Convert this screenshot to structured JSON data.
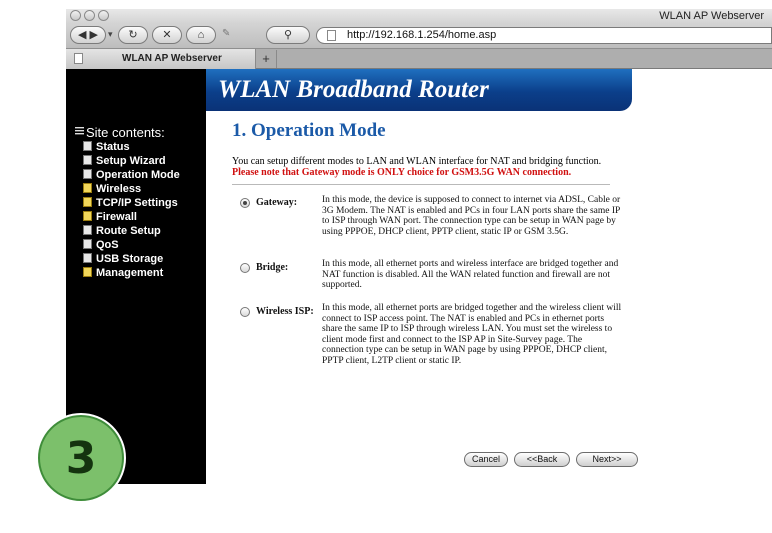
{
  "window": {
    "title": "WLAN AP Webserver"
  },
  "toolbar": {
    "back_icon": "back-arrow-icon",
    "forward_icon": "forward-arrow-icon",
    "reload_icon": "reload-icon",
    "stop_icon": "stop-icon",
    "home_icon": "home-icon",
    "url": "http://192.168.1.254/home.asp"
  },
  "tabs": [
    {
      "label": "WLAN AP Webserver"
    }
  ],
  "banner": {
    "title": "WLAN Broadband Router"
  },
  "sidebar": {
    "heading": "Site contents:",
    "items": [
      {
        "label": "Status",
        "icon": "page-icon"
      },
      {
        "label": "Setup Wizard",
        "icon": "page-icon"
      },
      {
        "label": "Operation Mode",
        "icon": "page-icon"
      },
      {
        "label": "Wireless",
        "icon": "folder-icon"
      },
      {
        "label": "TCP/IP Settings",
        "icon": "folder-icon"
      },
      {
        "label": "Firewall",
        "icon": "folder-icon"
      },
      {
        "label": "Route Setup",
        "icon": "page-icon"
      },
      {
        "label": "QoS",
        "icon": "page-icon"
      },
      {
        "label": "USB Storage",
        "icon": "page-icon"
      },
      {
        "label": "Management",
        "icon": "folder-icon"
      }
    ]
  },
  "main": {
    "title": "1. Operation Mode",
    "intro": "You can setup different modes to LAN and WLAN interface for NAT and bridging function.",
    "warning": "Please note that Gateway mode is ONLY choice for GSM3.5G WAN connection.",
    "options": [
      {
        "label": "Gateway:",
        "selected": true,
        "desc": "In this mode, the device is supposed to connect to internet via ADSL, Cable or 3G Modem. The NAT is enabled and PCs in four LAN ports share the same IP to ISP through WAN port. The connection type can be setup in WAN page by using PPPOE, DHCP client, PPTP client, static IP or GSM 3.5G."
      },
      {
        "label": "Bridge:",
        "selected": false,
        "desc": "In this mode, all ethernet ports and wireless interface are bridged together and NAT function is disabled. All the WAN related function and firewall are not supported."
      },
      {
        "label": "Wireless ISP:",
        "selected": false,
        "desc": "In this mode, all ethernet ports are bridged together and the wireless client will connect to ISP access point. The NAT is enabled and PCs in ethernet ports share the same IP to ISP through wireless LAN. You must set the wireless to client mode first and connect to the ISP AP in Site-Survey page. The connection type can be setup in WAN page by using PPPOE, DHCP client, PPTP client, L2TP client or static IP."
      }
    ],
    "buttons": {
      "cancel": "Cancel",
      "back": "<<Back",
      "next": "Next>>"
    }
  },
  "step_badge": {
    "number": "3"
  },
  "colors": {
    "banner": "#0b3f8a",
    "title": "#1b5aa8",
    "warning": "#d01010",
    "badge": "#7cc06b"
  }
}
